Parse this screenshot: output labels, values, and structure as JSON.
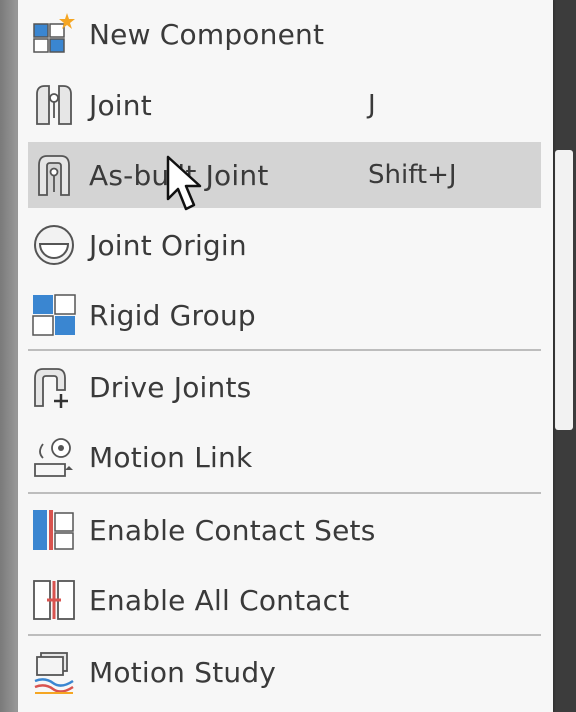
{
  "menu": {
    "items": [
      {
        "label": "New Component",
        "icon": "new-component-icon",
        "shortcut": ""
      },
      {
        "label": "Joint",
        "icon": "joint-icon",
        "shortcut": "J"
      },
      {
        "label": "As-built Joint",
        "icon": "as-built-joint-icon",
        "shortcut": "Shift+J"
      },
      {
        "label": "Joint Origin",
        "icon": "joint-origin-icon",
        "shortcut": ""
      },
      {
        "label": "Rigid Group",
        "icon": "rigid-group-icon",
        "shortcut": ""
      },
      {
        "label": "Drive Joints",
        "icon": "drive-joints-icon",
        "shortcut": ""
      },
      {
        "label": "Motion Link",
        "icon": "motion-link-icon",
        "shortcut": ""
      },
      {
        "label": "Enable Contact Sets",
        "icon": "enable-contact-sets-icon",
        "shortcut": ""
      },
      {
        "label": "Enable All Contact",
        "icon": "enable-all-contact-icon",
        "shortcut": ""
      },
      {
        "label": "Motion Study",
        "icon": "motion-study-icon",
        "shortcut": ""
      }
    ],
    "highlighted_item": "As-built Joint"
  },
  "colors": {
    "menu_bg": "#f7f7f7",
    "highlight_bg": "#d4d4d4",
    "text": "#3a3a3a",
    "accent_blue": "#3a86d1",
    "accent_red": "#d9534f",
    "accent_orange": "#f5a623"
  }
}
